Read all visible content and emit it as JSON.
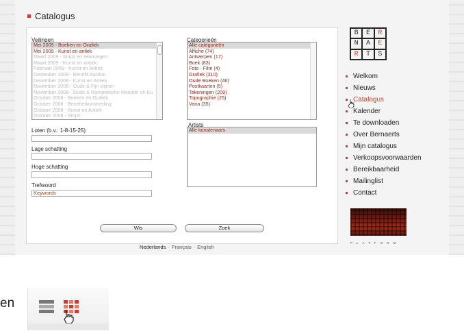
{
  "page": {
    "title": "Catalogus"
  },
  "left_form": {
    "veilingen_label": "Veilingen",
    "veilingen_items": [
      {
        "text": "Mei 2009 - Boeken en Grafiek",
        "state": "sel"
      },
      {
        "text": "Mei 2009 - Kunst en antiek",
        "state": "hi"
      },
      {
        "text": "Maart 2009 - Strips en tekeningen",
        "state": "dim"
      },
      {
        "text": "Maart 2009 - Kunst en antiek",
        "state": "dim"
      },
      {
        "text": "Februari 2009 - Kunst en Antiek",
        "state": "dim"
      },
      {
        "text": "December 2008 - Benefit Auction",
        "state": "dim"
      },
      {
        "text": "December 2008 - Kunst en Antiek",
        "state": "dim"
      },
      {
        "text": "November 2008 - Oude & Fijn wijnen",
        "state": "dim"
      },
      {
        "text": "November 2008 - Oude & Romantische Meester en Ku",
        "state": "dim"
      },
      {
        "text": "October 2008 - Boeken en Grafiek",
        "state": "dim"
      },
      {
        "text": "October 2008 - Benefietkunstveiling",
        "state": "dim"
      },
      {
        "text": "October 2008 - Kunst en Antiek",
        "state": "dim"
      },
      {
        "text": "October 2008 - Strips",
        "state": "dim"
      }
    ],
    "loten_label": "Loten (b.v.: 1-8-15-25)",
    "loten_value": "",
    "lage_label": "Lage schatting",
    "lage_value": "",
    "hoge_label": "Hoge schatting",
    "hoge_value": "",
    "trefwoord_label": "Trefwoord",
    "trefwoord_value": "Keywords"
  },
  "right_form": {
    "categorieen_label": "Categorieën",
    "categorieen_items": [
      {
        "text": "Alle categorieën",
        "state": "sel"
      },
      {
        "text": "Affiche  (74)",
        "state": "hi"
      },
      {
        "text": "Antwerpen  (17)",
        "state": "hi"
      },
      {
        "text": "Boek  (83)",
        "state": "hi"
      },
      {
        "text": "Foto - Film  (4)",
        "state": "hi"
      },
      {
        "text": "Grafiek  (310)",
        "state": "hi"
      },
      {
        "text": "Oude Boeken  (46)",
        "state": "hi"
      },
      {
        "text": "Postkaarten  (5)",
        "state": "hi"
      },
      {
        "text": "Tekeningen  (209)",
        "state": "hi"
      },
      {
        "text": "Topographie  (25)",
        "state": "hi"
      },
      {
        "text": "Varia  (35)",
        "state": "hi"
      }
    ],
    "artists_label": "Artists",
    "artists_items": [
      {
        "text": "Alle kunstenaars",
        "state": "sel"
      }
    ]
  },
  "buttons": {
    "wis": "Wis",
    "zoek": "Zoek"
  },
  "languages": {
    "nl": "Nederlands",
    "fr": "Français",
    "en": "English",
    "sep": "-"
  },
  "logo": {
    "letters": [
      "B",
      "E",
      "R",
      "N",
      "A",
      "E",
      "R",
      "T",
      "S"
    ]
  },
  "nav": {
    "items": [
      "Welkom",
      "Nieuws",
      "Catalogus",
      "Kalender",
      "Te downloaden",
      "Over Bernaerts",
      "Mijn catalogus",
      "Verkoopsvoorwaarden",
      "Bereikbaarheid",
      "Mailinglist",
      "Contact"
    ],
    "active_index": 2
  },
  "platform": {
    "label": "PLATFORM"
  },
  "bottom": {
    "fragment_text": "en"
  },
  "colors": {
    "accent": "#d23a2a",
    "selected_text": "#8a2a1a"
  }
}
